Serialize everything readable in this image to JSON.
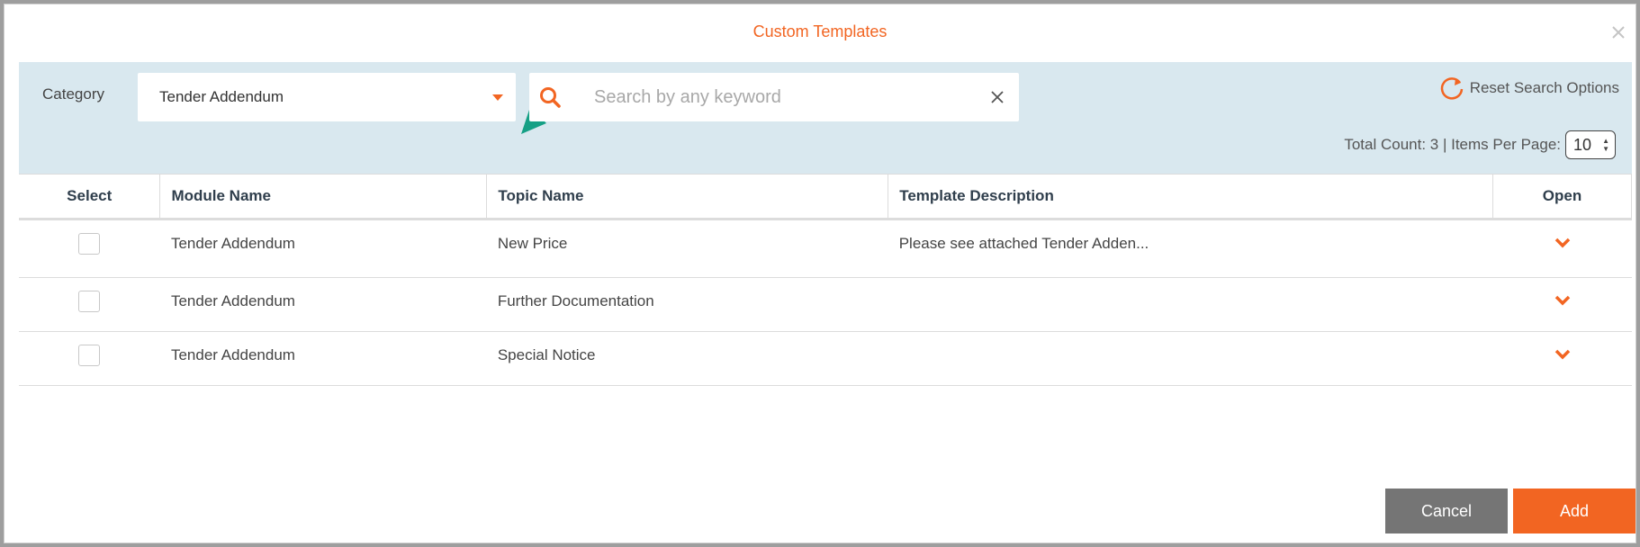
{
  "dialog": {
    "title": "Custom Templates"
  },
  "filters": {
    "category_label": "Category",
    "category_value": "Tender Addendum",
    "search_placeholder": "Search by any keyword",
    "search_value": "",
    "reset_label": "Reset Search Options",
    "count_text": "Total Count: 3 | Items Per Page:",
    "per_page": "10"
  },
  "table": {
    "headers": {
      "select": "Select",
      "module": "Module Name",
      "topic": "Topic Name",
      "description": "Template Description",
      "open": "Open"
    },
    "rows": [
      {
        "module": "Tender Addendum",
        "topic": "New Price",
        "description": "Please see attached Tender Adden..."
      },
      {
        "module": "Tender Addendum",
        "topic": "Further Documentation",
        "description": ""
      },
      {
        "module": "Tender Addendum",
        "topic": "Special Notice",
        "description": ""
      }
    ]
  },
  "footer": {
    "cancel_label": "Cancel",
    "add_label": "Add"
  },
  "colors": {
    "accent": "#f26522",
    "filter_bg": "#d9e8ef",
    "cancel_bg": "#757575",
    "annotation_arrow": "#16a085"
  },
  "icons": {
    "close": "close-icon",
    "caret": "caret-down-icon",
    "search": "search-icon",
    "clear": "clear-icon",
    "reset": "refresh-icon",
    "open": "chevron-down-icon",
    "annotation": "annotation-arrow-icon"
  }
}
